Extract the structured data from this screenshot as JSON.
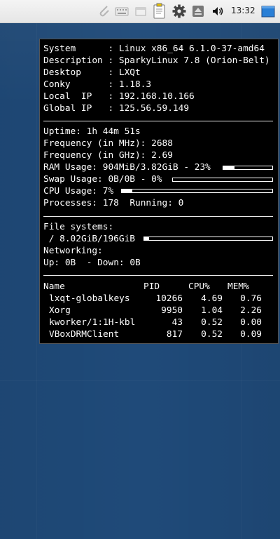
{
  "panel": {
    "clock": "13:32",
    "icons": [
      "paperclip-icon",
      "keyboard-icon",
      "window-icon",
      "clipboard-icon",
      "gear-icon",
      "eject-icon",
      "volume-icon",
      "desktop-icon"
    ]
  },
  "conky": {
    "system_info": [
      {
        "label": "System     ",
        "value": "Linux x86_64 6.1.0-37-amd64"
      },
      {
        "label": "Description",
        "value": "SparkyLinux 7.8 (Orion-Belt)"
      },
      {
        "label": "Desktop    ",
        "value": "LXQt"
      },
      {
        "label": "Conky      ",
        "value": "1.18.3"
      },
      {
        "label": "Local  IP  ",
        "value": "192.168.10.166"
      },
      {
        "label": "Global IP  ",
        "value": "125.56.59.149"
      }
    ],
    "uptime": {
      "label": "Uptime:",
      "value": "1h 44m 51s"
    },
    "freq_mhz": {
      "label": "Frequency (in MHz):",
      "value": "2688"
    },
    "freq_ghz": {
      "label": "Frequency (in GHz):",
      "value": "2.69"
    },
    "ram": {
      "label": "RAM Usage:",
      "value": "904MiB/3.82GiB - 23%",
      "percent": 23
    },
    "swap": {
      "label": "Swap Usage:",
      "value": "0B/0B - 0%",
      "percent": 0
    },
    "cpu": {
      "label": "CPU Usage:",
      "value": "7%",
      "percent": 7
    },
    "processes": {
      "label": "Processes:",
      "value": "178",
      "running_label": "Running:",
      "running_value": "0"
    },
    "filesystems": {
      "label": "File systems:",
      "root": "/ 8.02GiB/196GiB",
      "percent": 4
    },
    "networking": {
      "label": "Networking:",
      "up_label": "Up:",
      "up": "0B",
      "down_label": "- Down:",
      "down": "0B"
    },
    "proc_table": {
      "headers": [
        "Name",
        "PID",
        "CPU%",
        "MEM%"
      ],
      "rows": [
        [
          "lxqt-globalkeys",
          "10266",
          "4.69",
          "0.76"
        ],
        [
          "Xorg",
          "9950",
          "1.04",
          "2.26"
        ],
        [
          "kworker/1:1H-kbl",
          "43",
          "0.52",
          "0.00"
        ],
        [
          "VBoxDRMClient",
          "817",
          "0.52",
          "0.09"
        ]
      ]
    }
  }
}
